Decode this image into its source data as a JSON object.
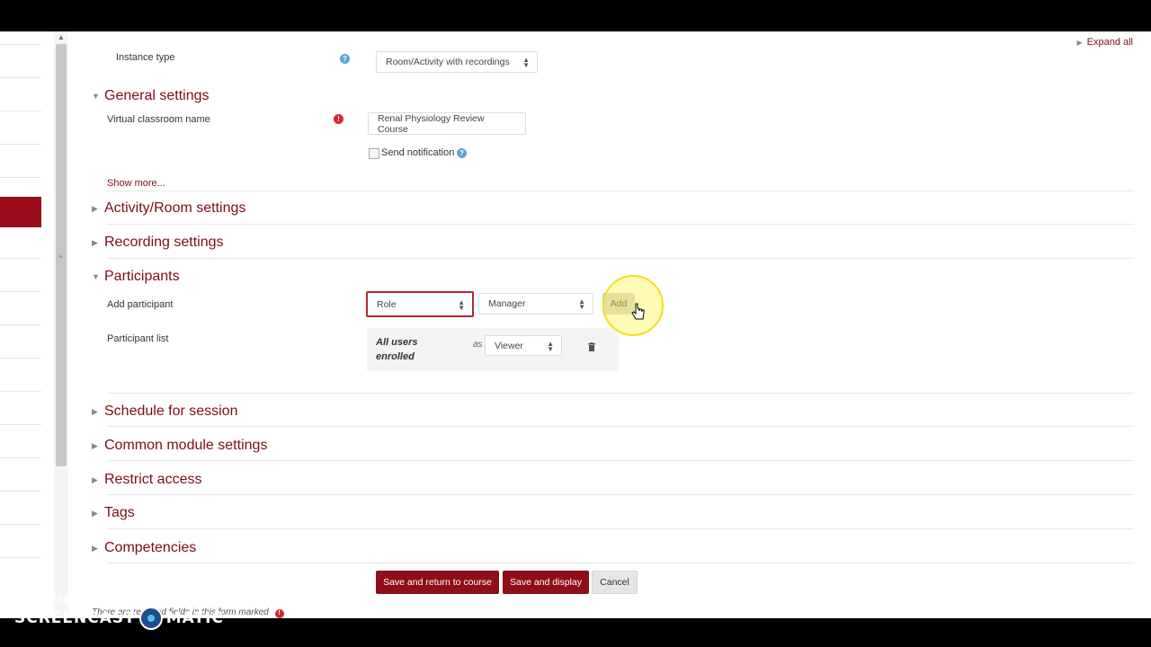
{
  "header": {
    "expand_all": "Expand all"
  },
  "instance_type": {
    "label": "Instance type",
    "value": "Room/Activity with recordings"
  },
  "sections": {
    "general": "General settings",
    "activity_room": "Activity/Room settings",
    "recording": "Recording settings",
    "participants": "Participants",
    "schedule": "Schedule for session",
    "common_module": "Common module settings",
    "restrict": "Restrict access",
    "tags": "Tags",
    "competencies": "Competencies"
  },
  "general": {
    "virtual_classroom_label": "Virtual classroom name",
    "virtual_classroom_value": "Renal Physiology Review Course",
    "send_notification": "Send notification",
    "show_more": "Show more..."
  },
  "participants": {
    "add_label": "Add participant",
    "type_select": "Role",
    "role_select": "Manager",
    "add_button": "Add",
    "list_label": "Participant list",
    "entry_name": "All users enrolled",
    "entry_as": "as",
    "entry_role": "Viewer"
  },
  "actions": {
    "save_return": "Save and return to course",
    "save_display": "Save and display",
    "cancel": "Cancel"
  },
  "footer": {
    "required_note": "There are required fields in this form marked"
  },
  "watermark": {
    "line1": "RECORDED WITH",
    "line2a": "SCREENCAST",
    "line2b": "MATIC"
  },
  "colors": {
    "accent": "#7a0e18",
    "primary_button": "#8e0e1a",
    "help": "#5aa6d6",
    "required": "#d7282f",
    "highlight": "#f2df1d"
  },
  "icons": [
    "help-icon",
    "required-icon",
    "trash-icon",
    "expand-triangle-icon",
    "collapse-triangle-icon",
    "pointer-cursor-icon",
    "screencast-logo-icon"
  ]
}
